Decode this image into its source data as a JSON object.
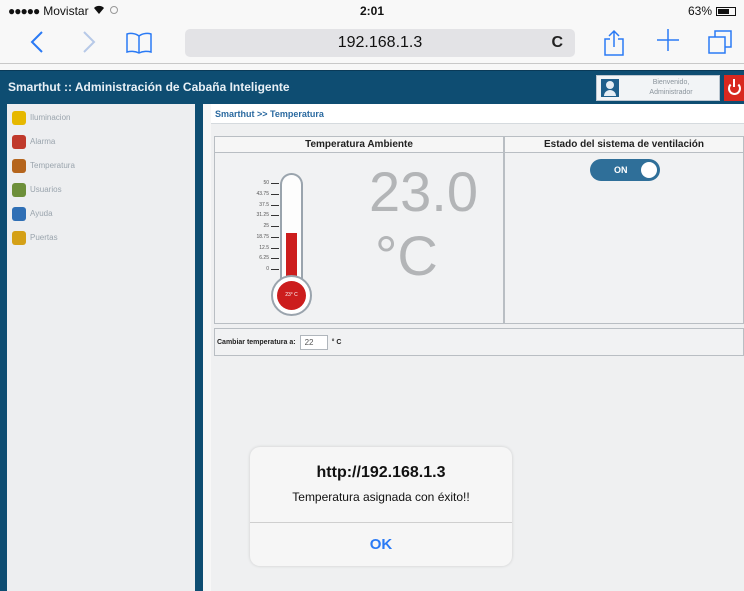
{
  "status_bar": {
    "carrier": "Movistar",
    "signal": "●●●●●",
    "time": "2:01",
    "battery": "63%"
  },
  "browser": {
    "url": "192.168.1.3",
    "reload_icon": "C",
    "accent": "#2a7af5"
  },
  "app": {
    "title": "Smarthut :: Administración de Cabaña Inteligente",
    "user_greeting": "Bienvenido,",
    "user_name": "Administrador",
    "brand_color": "#0e4d72",
    "power_color": "#d8281f"
  },
  "sidebar": {
    "items": [
      {
        "label": "Iluminacion",
        "icon": "lightbulb-icon",
        "color": "#e6b800"
      },
      {
        "label": "Alarma",
        "icon": "alarm-icon",
        "color": "#c0392b"
      },
      {
        "label": "Temperatura",
        "icon": "thermometer-icon",
        "color": "#b5651d"
      },
      {
        "label": "Usuarios",
        "icon": "users-icon",
        "color": "#6d8f3a"
      },
      {
        "label": "Ayuda",
        "icon": "help-icon",
        "color": "#2f6fb5"
      },
      {
        "label": "Puertas",
        "icon": "door-icon",
        "color": "#d4a017"
      }
    ]
  },
  "main": {
    "breadcrumb": "Smarthut >> Temperatura",
    "ambient": {
      "heading": "Temperatura Ambiente",
      "value": "23.0",
      "unit": "°C",
      "scale": [
        "50",
        "43.75",
        "37.5",
        "31.25",
        "25",
        "18.75",
        "12.5",
        "6.25",
        "0"
      ],
      "bulb_label": "23° C",
      "fill_fraction": 0.46
    },
    "ventilation": {
      "heading": "Estado del sistema de ventilación",
      "toggle_label": "ON"
    },
    "change_temp": {
      "label": "Cambiar temperatura a:",
      "value": "22",
      "unit": "° C"
    }
  },
  "alert": {
    "title": "http://192.168.1.3",
    "message": "Temperatura asignada con éxito!!",
    "ok_label": "OK"
  }
}
